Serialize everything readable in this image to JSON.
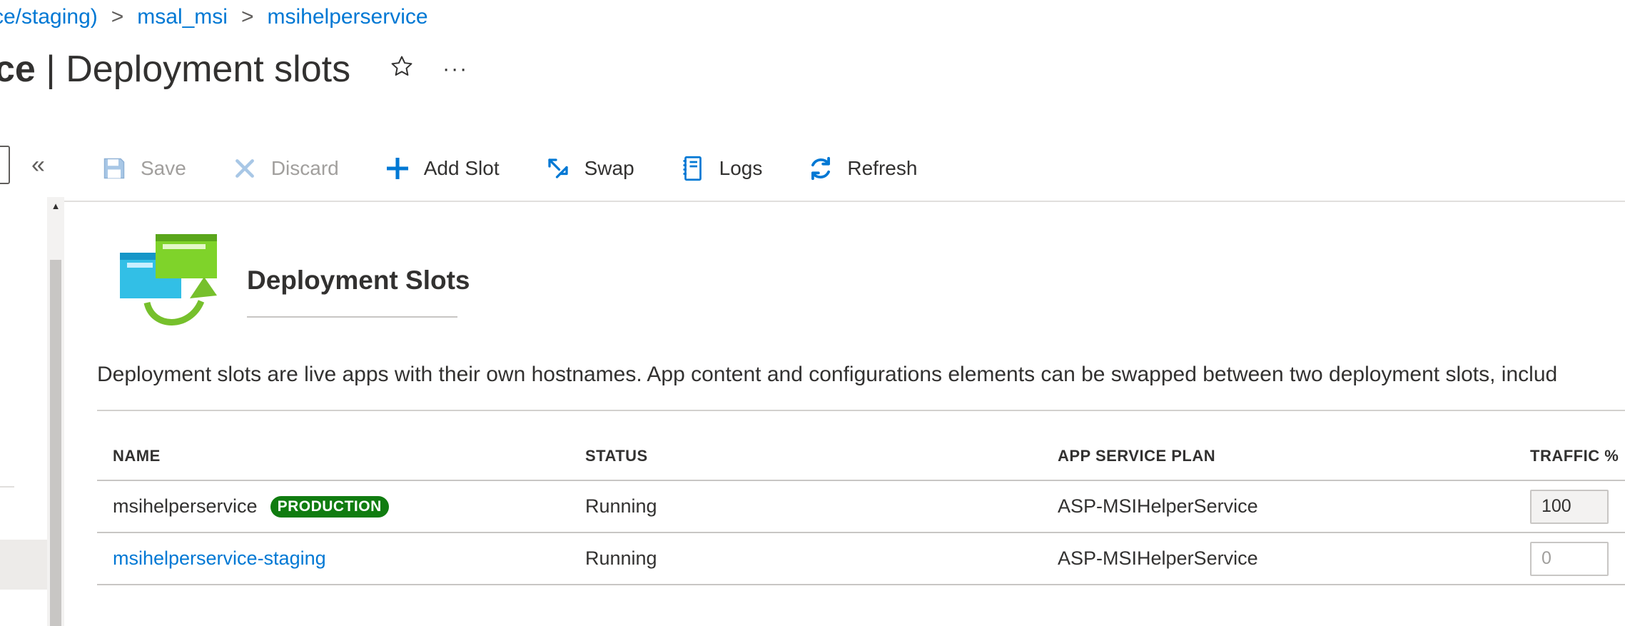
{
  "breadcrumb": {
    "items": [
      "ce/staging)",
      "msal_msi",
      "msihelperservice"
    ],
    "separator": ">"
  },
  "title": {
    "prefix": "ce",
    "divider": " | ",
    "section": "Deployment slots",
    "favorite_icon": "star-icon",
    "more_icon": "ellipsis-icon",
    "more_label": "···"
  },
  "sidebar": {
    "collapse_label": "«"
  },
  "toolbar": {
    "save_label": "Save",
    "discard_label": "Discard",
    "add_slot_label": "Add Slot",
    "swap_label": "Swap",
    "logs_label": "Logs",
    "refresh_label": "Refresh"
  },
  "content": {
    "heading": "Deployment Slots",
    "description": "Deployment slots are live apps with their own hostnames. App content and configurations elements can be swapped between two deployment slots, includ"
  },
  "table": {
    "headers": [
      "NAME",
      "STATUS",
      "APP SERVICE PLAN",
      "TRAFFIC %"
    ],
    "rows": [
      {
        "name": "msihelperservice",
        "badge": "PRODUCTION",
        "status": "Running",
        "plan": "ASP-MSIHelperService",
        "traffic_value": "100"
      },
      {
        "name": "msihelperservice-staging",
        "status": "Running",
        "plan": "ASP-MSIHelperService",
        "traffic_placeholder": "0"
      }
    ]
  },
  "colors": {
    "link": "#0078d4",
    "production_badge": "#107c10",
    "text": "#323130",
    "disabled": "#a19f9d"
  }
}
